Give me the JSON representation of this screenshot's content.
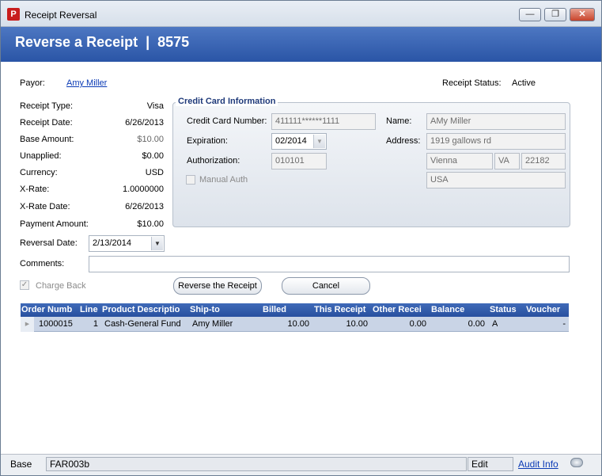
{
  "window": {
    "title": "Receipt Reversal",
    "minimize_glyph": "—",
    "maximize_glyph": "❐",
    "close_glyph": "✕"
  },
  "header": {
    "title": "Reverse a Receipt  |  8575"
  },
  "payor": {
    "label": "Payor:",
    "name": "Amy Miller"
  },
  "receipt_status": {
    "label": "Receipt Status:",
    "value": "Active"
  },
  "details": [
    {
      "label": "Receipt Type:",
      "value": "Visa",
      "muted": false
    },
    {
      "label": "Receipt Date:",
      "value": "6/26/2013",
      "muted": false
    },
    {
      "label": "Base Amount:",
      "value": "$10.00",
      "muted": true
    },
    {
      "label": "Unapplied:",
      "value": "$0.00",
      "muted": false
    },
    {
      "label": "Currency:",
      "value": "USD",
      "muted": false
    },
    {
      "label": "X-Rate:",
      "value": "1.0000000",
      "muted": false
    },
    {
      "label": "X-Rate Date:",
      "value": "6/26/2013",
      "muted": false
    },
    {
      "label": "Payment Amount:",
      "value": "$10.00",
      "muted": false
    }
  ],
  "reversal_date": {
    "label": "Reversal Date:",
    "value": "2/13/2014"
  },
  "comments": {
    "label": "Comments:",
    "value": ""
  },
  "credit_card": {
    "group_title": "Credit Card Information",
    "number_label": "Credit Card Number:",
    "number_value": "411111******1111",
    "expiration_label": "Expiration:",
    "expiration_value": "02/2014",
    "authorization_label": "Authorization:",
    "authorization_value": "010101",
    "manual_auth_label": "Manual Auth",
    "manual_auth_checked": false,
    "name_label": "Name:",
    "name_value": "AMy Miller",
    "address_label": "Address:",
    "address_value": "1919 gallows rd",
    "city_value": "Vienna",
    "state_value": "VA",
    "zip_value": "22182",
    "country_value": "USA"
  },
  "charge_back": {
    "label": "Charge Back",
    "checked": true,
    "check_glyph": "✓"
  },
  "buttons": {
    "reverse": "Reverse the Receipt",
    "cancel": "Cancel"
  },
  "grid": {
    "columns": [
      "Order Numb",
      "Line",
      "Product Descriptio",
      "Ship-to",
      "Billed",
      "This Receipt",
      "Other Recei",
      "Balance",
      "Status",
      "Voucher"
    ],
    "rows": [
      {
        "order": "1000015",
        "line": "1",
        "product": "Cash-General Fund",
        "ship_to": "Amy Miller",
        "billed": "10.00",
        "this_receipt": "10.00",
        "other_receipts": "0.00",
        "balance": "0.00",
        "status": "A",
        "voucher": "-"
      }
    ]
  },
  "statusbar": {
    "base": "Base",
    "screen_code": "FAR003b",
    "mode": "Edit",
    "audit_link": "Audit Info"
  },
  "icons": {
    "app": "app-logo-icon",
    "row_pointer": "row-pointer-icon",
    "dropdown": "chevron-down-icon",
    "status": "cloud-icon"
  }
}
